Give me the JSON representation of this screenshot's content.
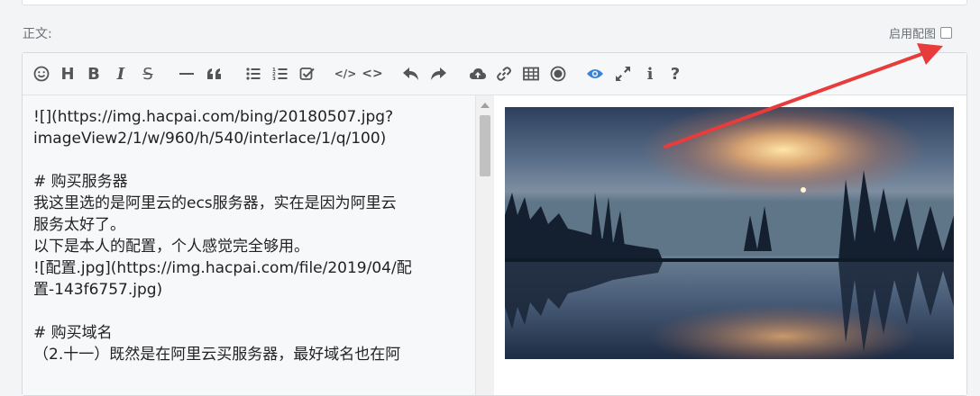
{
  "form": {
    "body_label": "正文:",
    "enable_image_label": "启用配图"
  },
  "toolbar": {
    "items": [
      {
        "name": "emoji-icon"
      },
      {
        "name": "heading-icon",
        "glyph": "H"
      },
      {
        "name": "bold-icon",
        "glyph": "B"
      },
      {
        "name": "italic-icon",
        "glyph": "I"
      },
      {
        "name": "strike-icon",
        "glyph": "S"
      },
      {
        "name": "horizontal-rule-icon"
      },
      {
        "name": "quote-icon"
      },
      {
        "name": "unordered-list-icon"
      },
      {
        "name": "ordered-list-icon"
      },
      {
        "name": "check-list-icon"
      },
      {
        "name": "code-block-icon",
        "glyph": "</>"
      },
      {
        "name": "inline-code-icon",
        "glyph": "<>"
      },
      {
        "name": "undo-icon"
      },
      {
        "name": "redo-icon"
      },
      {
        "name": "upload-icon"
      },
      {
        "name": "link-icon"
      },
      {
        "name": "table-icon"
      },
      {
        "name": "record-icon"
      },
      {
        "name": "preview-icon",
        "active": true
      },
      {
        "name": "fullscreen-icon"
      },
      {
        "name": "info-icon",
        "glyph": "i"
      },
      {
        "name": "help-icon",
        "glyph": "?"
      }
    ],
    "active_color": "#3b82d6"
  },
  "editor": {
    "lines": [
      "![](https://img.hacpai.com/bing/20180507.jpg?",
      "imageView2/1/w/960/h/540/interlace/1/q/100)",
      "",
      "# 购买服务器",
      "我这里选的是阿里云的ecs服务器，实在是因为阿里云",
      "服务太好了。",
      "以下是本人的配置，个人感觉完全够用。",
      "![配置.jpg](https://img.hacpai.com/file/2019/04/配",
      "置-143f6757.jpg)",
      "",
      "# 购买域名",
      "（2.十一）既然是在阿里云买服务器，最好域名也在阿"
    ]
  },
  "annotation": {
    "arrow_color": "#e83c3c"
  }
}
